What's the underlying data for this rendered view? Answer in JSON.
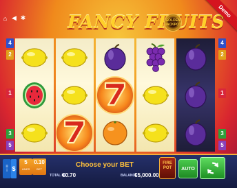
{
  "game": {
    "title": "FANCY FRUITS",
    "jackpot_badge_text": "GOLDEN\nJACKPOT",
    "demo_label": "Demo"
  },
  "top_icons": [
    "home-icon",
    "volume-icon",
    "settings-icon"
  ],
  "paylines": {
    "left": [
      {
        "num": "4",
        "color": "#2f4fc9"
      },
      {
        "num": "2",
        "color": "#e0a01a"
      },
      {
        "num": "1",
        "color": "#d9263a"
      },
      {
        "num": "3",
        "color": "#2f9f3a"
      },
      {
        "num": "5",
        "color": "#8a3fb9"
      }
    ],
    "right": [
      {
        "num": "4",
        "color": "#2f4fc9"
      },
      {
        "num": "2",
        "color": "#e0a01a"
      },
      {
        "num": "1",
        "color": "#d9263a"
      },
      {
        "num": "3",
        "color": "#2f9f3a"
      },
      {
        "num": "5",
        "color": "#8a3fb9"
      }
    ]
  },
  "reels": [
    [
      "lemon",
      "watermelon",
      "lemon"
    ],
    [
      "lemon",
      "lemon",
      "seven"
    ],
    [
      "plum",
      "seven",
      "orange"
    ],
    [
      "grapes",
      "lemon",
      "lemon"
    ],
    [
      "plum",
      "plum",
      "plum"
    ]
  ],
  "controls": {
    "lines_value": "5",
    "lines_label": "LINES",
    "bet_value": "0.10",
    "bet_label": "BET",
    "total_bet_label": "TOTAL BET",
    "total_bet_value": "€0.70",
    "message": "Choose your BET",
    "balance_label": "BALANCE",
    "balance_value": "€5,000.00",
    "firepot_label": "FIRE\nPOT",
    "auto_label": "AUTO"
  },
  "colors": {
    "lemon": "#f5e11c",
    "plum": "#5a2c9a",
    "grapes": "#7b2bb0",
    "orange": "#f6921e",
    "watermelon_rind": "#2e9a3b",
    "watermelon_flesh": "#e8283b",
    "seven": "#d82a1e"
  }
}
